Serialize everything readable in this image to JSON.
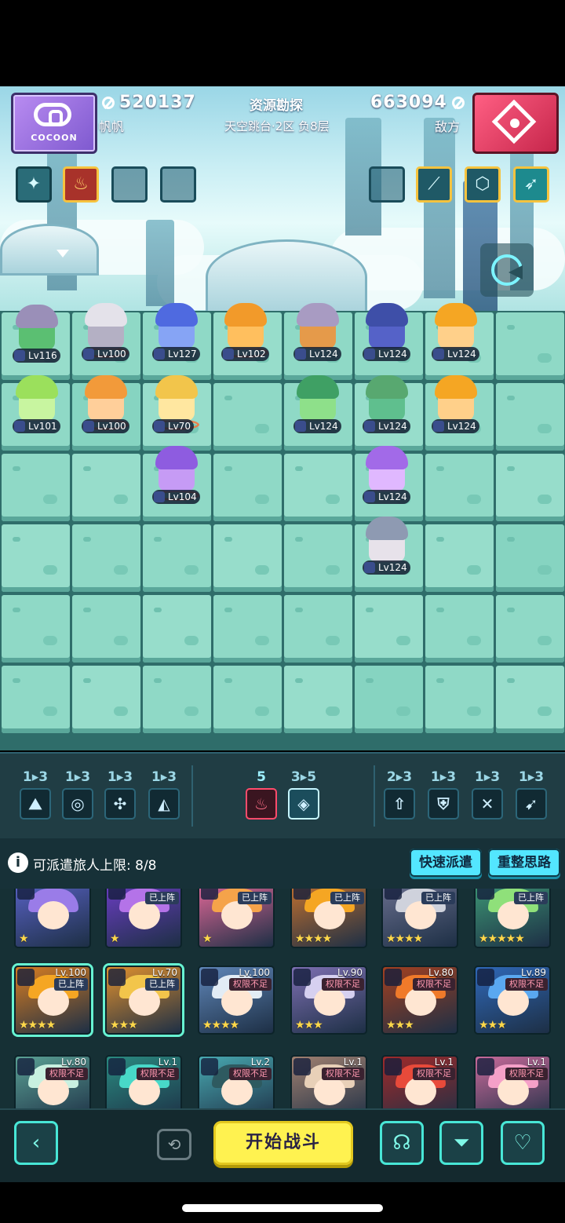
{
  "header": {
    "brand_label": "COCOON",
    "player_score": "520137",
    "player_name": "帆帆",
    "mode_title": "资源勘探",
    "stage_info": "天空跳台·2区  负8层",
    "enemy_score": "663094",
    "enemy_label": "敌方"
  },
  "skills_left": [
    {
      "icon": "wand-sparkle-icon"
    },
    {
      "icon": "flame-icon"
    },
    {
      "icon": "empty-slot"
    },
    {
      "icon": "empty-slot"
    }
  ],
  "skills_right": [
    {
      "icon": "empty-slot"
    },
    {
      "icon": "sword-strike-icon"
    },
    {
      "icon": "hex-shield-icon"
    },
    {
      "icon": "sprint-icon"
    }
  ],
  "board_units": [
    {
      "lv": "Lv116",
      "hair": "#9a8fb8",
      "body": "#5bbf72"
    },
    {
      "lv": "Lv100",
      "hair": "#e4e2ea",
      "body": "#b4b0c4"
    },
    {
      "lv": "Lv127",
      "hair": "#4f6ae0",
      "body": "#86a4f5"
    },
    {
      "lv": "Lv102",
      "hair": "#f29a2a",
      "body": "#ffbf5e"
    },
    {
      "lv": "Lv124",
      "hair": "#a89bc2",
      "body": "#e59a4a"
    },
    {
      "lv": "Lv124",
      "hair": "#3e4fa8",
      "body": "#5562c8"
    },
    {
      "lv": "Lv124",
      "hair": "#f5a623",
      "body": "#ffd08a"
    },
    {
      "lv": "Lv101",
      "hair": "#9be05c",
      "body": "#c8f5a0"
    },
    {
      "lv": "Lv100",
      "hair": "#f29a3a",
      "body": "#ffcf9a"
    },
    {
      "lv": "Lv70",
      "hair": "#f2c54b",
      "body": "#ffe7a0"
    },
    {
      "lv": "Lv124",
      "hair": "#3fa064",
      "body": "#8ee08a"
    },
    {
      "lv": "Lv124",
      "hair": "#58a870",
      "body": "#5fbf8e"
    },
    {
      "lv": "Lv124",
      "hair": "#f5a623",
      "body": "#ffd08a"
    },
    {
      "lv": "Lv104",
      "hair": "#8e5ce0",
      "body": "#c69bf5"
    },
    {
      "lv": "Lv124",
      "hair": "#a26ae8",
      "body": "#e0b8ff"
    },
    {
      "lv": "Lv124",
      "hair": "#8e9ab2",
      "body": "#e7e2ea"
    }
  ],
  "synergy": {
    "left": [
      {
        "count": "1▸3",
        "icon": "mountain-icon"
      },
      {
        "count": "1▸3",
        "icon": "swirl-icon"
      },
      {
        "count": "1▸3",
        "icon": "shuriken-icon"
      },
      {
        "count": "1▸3",
        "icon": "blade-icon"
      }
    ],
    "center": [
      {
        "count": "5",
        "icon": "fire-emblem-icon"
      },
      {
        "count": "3▸5",
        "icon": "diamond-emblem-icon"
      }
    ],
    "right": [
      {
        "count": "2▸3",
        "icon": "arrow-up-icon"
      },
      {
        "count": "1▸3",
        "icon": "shield-icon"
      },
      {
        "count": "1▸3",
        "icon": "crossed-swords-icon"
      },
      {
        "count": "1▸3",
        "icon": "bow-icon"
      }
    ]
  },
  "dispatch": {
    "label": "可派遣旅人上限:",
    "value": "8/8",
    "quick_button": "快速派遣",
    "rethink_button": "重整思路"
  },
  "roster": [
    {
      "tag": "",
      "lvl": "",
      "stars": "★",
      "hair": "#9a7ce8",
      "bg": "#5a63c8"
    },
    {
      "tag": "已上阵",
      "lvl": "",
      "stars": "★",
      "hair": "#b473e8",
      "bg": "#6e3ec8"
    },
    {
      "tag": "已上阵",
      "lvl": "",
      "stars": "★",
      "hair": "#f5a34a",
      "bg": "#e86a9a"
    },
    {
      "tag": "已上阵",
      "lvl": "",
      "stars": "★★★★",
      "hair": "#f5a623",
      "bg": "#c8732e"
    },
    {
      "tag": "已上阵",
      "lvl": "",
      "stars": "★★★★",
      "hair": "#cfd2dc",
      "bg": "#6b7090"
    },
    {
      "tag": "已上阵",
      "lvl": "",
      "stars": "★★★★★",
      "hair": "#8fe07a",
      "bg": "#3e9a76"
    },
    {
      "tag": "已上阵",
      "lvl": "Lv.100",
      "stars": "★★★★",
      "hair": "#f5a623",
      "bg": "#d77d22"
    },
    {
      "tag": "已上阵",
      "lvl": "Lv.70",
      "stars": "★★★",
      "hair": "#f2c54b",
      "bg": "#e0902e"
    },
    {
      "tag": "权限不足",
      "lvl": "Lv.100",
      "stars": "★★★★",
      "hair": "#e2ecf5",
      "bg": "#5f86b8"
    },
    {
      "tag": "权限不足",
      "lvl": "Lv.90",
      "stars": "★★★",
      "hair": "#d6d0f0",
      "bg": "#7d6fb2"
    },
    {
      "tag": "权限不足",
      "lvl": "Lv.80",
      "stars": "★★★",
      "hair": "#f07a2a",
      "bg": "#a34020"
    },
    {
      "tag": "权限不足",
      "lvl": "Lv.89",
      "stars": "★★★",
      "hair": "#5aa8f0",
      "bg": "#2f68b8"
    },
    {
      "tag": "权限不足",
      "lvl": "Lv.80",
      "stars": "",
      "hair": "#c8f0e0",
      "bg": "#5aa094"
    },
    {
      "tag": "权限不足",
      "lvl": "Lv.1",
      "stars": "",
      "hair": "#48d8c8",
      "bg": "#2a8a80"
    },
    {
      "tag": "权限不足",
      "lvl": "Lv.2",
      "stars": "",
      "hair": "#2e5a60",
      "bg": "#48a8b0"
    },
    {
      "tag": "权限不足",
      "lvl": "Lv.1",
      "stars": "",
      "hair": "#e8d0b8",
      "bg": "#a08070"
    },
    {
      "tag": "权限不足",
      "lvl": "Lv.1",
      "stars": "",
      "hair": "#e84a3a",
      "bg": "#a02a2a"
    },
    {
      "tag": "权限不足",
      "lvl": "Lv.1",
      "stars": "",
      "hair": "#f5a0c8",
      "bg": "#c86a9a"
    }
  ],
  "bottom": {
    "back_icon": "chevron-left-icon",
    "camera_icon": "camera-rotate-icon",
    "start_label": "开始战斗",
    "brain_icon": "brain-icon",
    "filter_icon": "filter-icon",
    "sort_icon": "sort-heart-icon"
  },
  "colors": {
    "accent": "#53e6ff",
    "start": "#fff250",
    "board": "#8fd9c6"
  }
}
